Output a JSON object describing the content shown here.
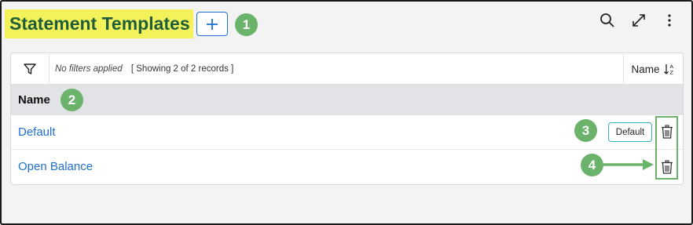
{
  "header": {
    "title": "Statement Templates",
    "add_label": "+"
  },
  "callouts": [
    "1",
    "2",
    "3",
    "4"
  ],
  "filterbar": {
    "no_filters": "No filters applied",
    "showing": "[ Showing 2 of 2 records ]",
    "sort_label": "Name"
  },
  "table": {
    "column_header": "Name",
    "rows": [
      {
        "name": "Default",
        "badge": "Default"
      },
      {
        "name": "Open Balance",
        "badge": ""
      }
    ]
  },
  "colors": {
    "title_highlight": "#f4f25a",
    "title_text": "#1e5c3a",
    "accent_blue": "#1e6fd9",
    "callout_green": "#6bb36b",
    "default_pill_border": "#2bb3c0"
  },
  "icons": [
    "search-icon",
    "expand-icon",
    "more-vertical-icon",
    "filter-icon",
    "sort-alpha-icon",
    "trash-icon"
  ]
}
